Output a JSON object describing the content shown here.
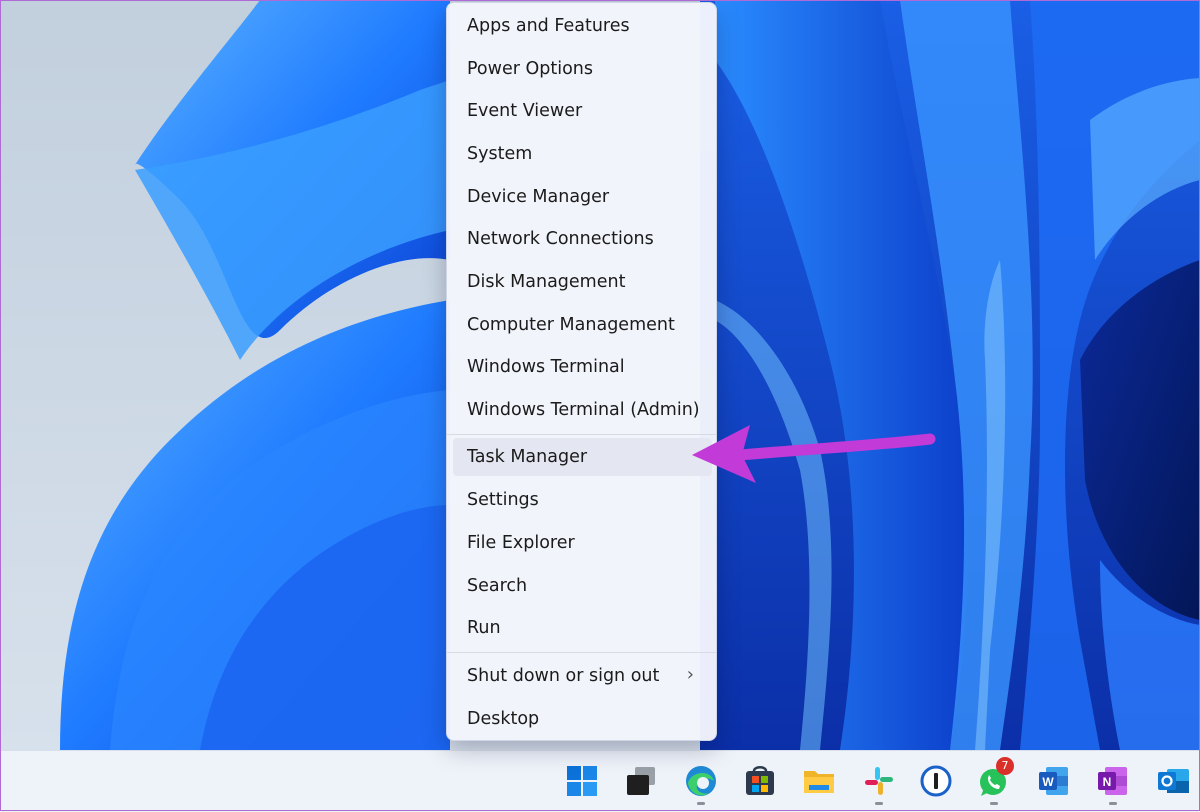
{
  "menu": {
    "items": [
      {
        "label": "Apps and Features"
      },
      {
        "label": "Power Options"
      },
      {
        "label": "Event Viewer"
      },
      {
        "label": "System"
      },
      {
        "label": "Device Manager"
      },
      {
        "label": "Network Connections"
      },
      {
        "label": "Disk Management"
      },
      {
        "label": "Computer Management"
      },
      {
        "label": "Windows Terminal"
      },
      {
        "label": "Windows Terminal (Admin)"
      },
      {
        "label": "Task Manager",
        "highlighted": true
      },
      {
        "label": "Settings"
      },
      {
        "label": "File Explorer"
      },
      {
        "label": "Search"
      },
      {
        "label": "Run"
      },
      {
        "label": "Shut down or sign out",
        "submenu": true
      },
      {
        "label": "Desktop"
      }
    ],
    "submenu_glyph": "›"
  },
  "annotation": {
    "color": "#c23ad8",
    "target": "Task Manager"
  },
  "taskbar": {
    "icons": [
      {
        "name": "start-icon"
      },
      {
        "name": "task-view-icon"
      },
      {
        "name": "edge-icon",
        "running": true
      },
      {
        "name": "store-icon"
      },
      {
        "name": "file-explorer-icon"
      },
      {
        "name": "slack-icon",
        "running": true
      },
      {
        "name": "1password-icon"
      },
      {
        "name": "whatsapp-icon",
        "running": true,
        "badge": "7"
      },
      {
        "name": "word-icon"
      },
      {
        "name": "onenote-icon",
        "running": true
      },
      {
        "name": "outlook-icon"
      }
    ]
  },
  "colors": {
    "wallpaper_blue": "#1f5fe8",
    "menu_bg": "#f3f5fc",
    "highlight": "#e4e7f1",
    "taskbar_bg": "#eef2f9",
    "badge_red": "#d9302a"
  }
}
